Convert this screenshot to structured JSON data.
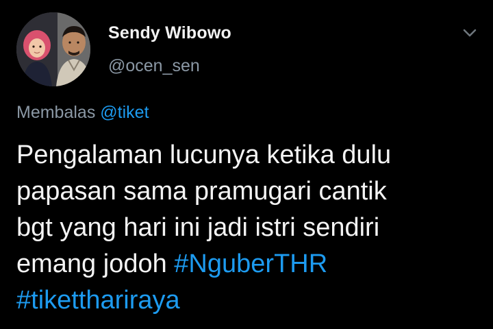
{
  "author": {
    "display_name": "Sendy Wibowo",
    "handle": "@ocen_sen",
    "avatar_icon": "profile-photo"
  },
  "menu": {
    "icon": "chevron-down-icon"
  },
  "reply": {
    "prefix": "Membalas",
    "mention": "@tiket"
  },
  "body": {
    "lines": [
      "Pengalaman lucunya ketika dulu",
      "papasan sama pramugari cantik",
      "bgt yang hari ini jadi istri sendiri",
      "emang jodoh "
    ],
    "hashtags": [
      "#NguberTHR",
      "#tiketthariraya"
    ]
  },
  "colors": {
    "background": "#000000",
    "text": "#f4f4f4",
    "secondary_text": "#8b98a5",
    "link": "#1d9bf0"
  }
}
